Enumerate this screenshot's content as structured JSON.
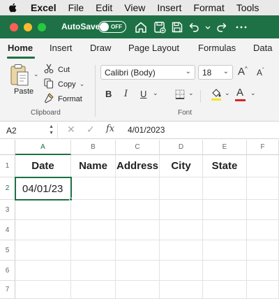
{
  "menubar": {
    "app": "Excel",
    "items": [
      "File",
      "Edit",
      "View",
      "Insert",
      "Format",
      "Tools"
    ]
  },
  "titlebar": {
    "autosave_label": "AutoSave",
    "toggle_state": "OFF"
  },
  "ribbon_tabs": [
    "Home",
    "Insert",
    "Draw",
    "Page Layout",
    "Formulas",
    "Data"
  ],
  "clipboard": {
    "paste_label": "Paste",
    "cut_label": "Cut",
    "copy_label": "Copy",
    "format_label": "Format",
    "group_label": "Clipboard"
  },
  "font": {
    "family": "Calibri (Body)",
    "size": "18",
    "group_label": "Font",
    "bold": "B",
    "italic": "I",
    "underline": "U",
    "grow": "A",
    "shrink": "A",
    "font_color_glyph": "A"
  },
  "formula_bar": {
    "cell_ref": "A2",
    "fx": "fx",
    "value": "4/01/2023"
  },
  "sheet": {
    "columns": [
      "A",
      "B",
      "C",
      "D",
      "E",
      "F"
    ],
    "rows": [
      "1",
      "2",
      "3",
      "4",
      "5",
      "6",
      "7"
    ],
    "headers": [
      "Date",
      "Name",
      "Address",
      "City",
      "State"
    ],
    "a2_value": "04/01/23",
    "selected_cell": "A2"
  },
  "colors": {
    "accent": "#1e7145",
    "highlight_yellow": "#f5e51b",
    "font_red": "#d8232a"
  }
}
